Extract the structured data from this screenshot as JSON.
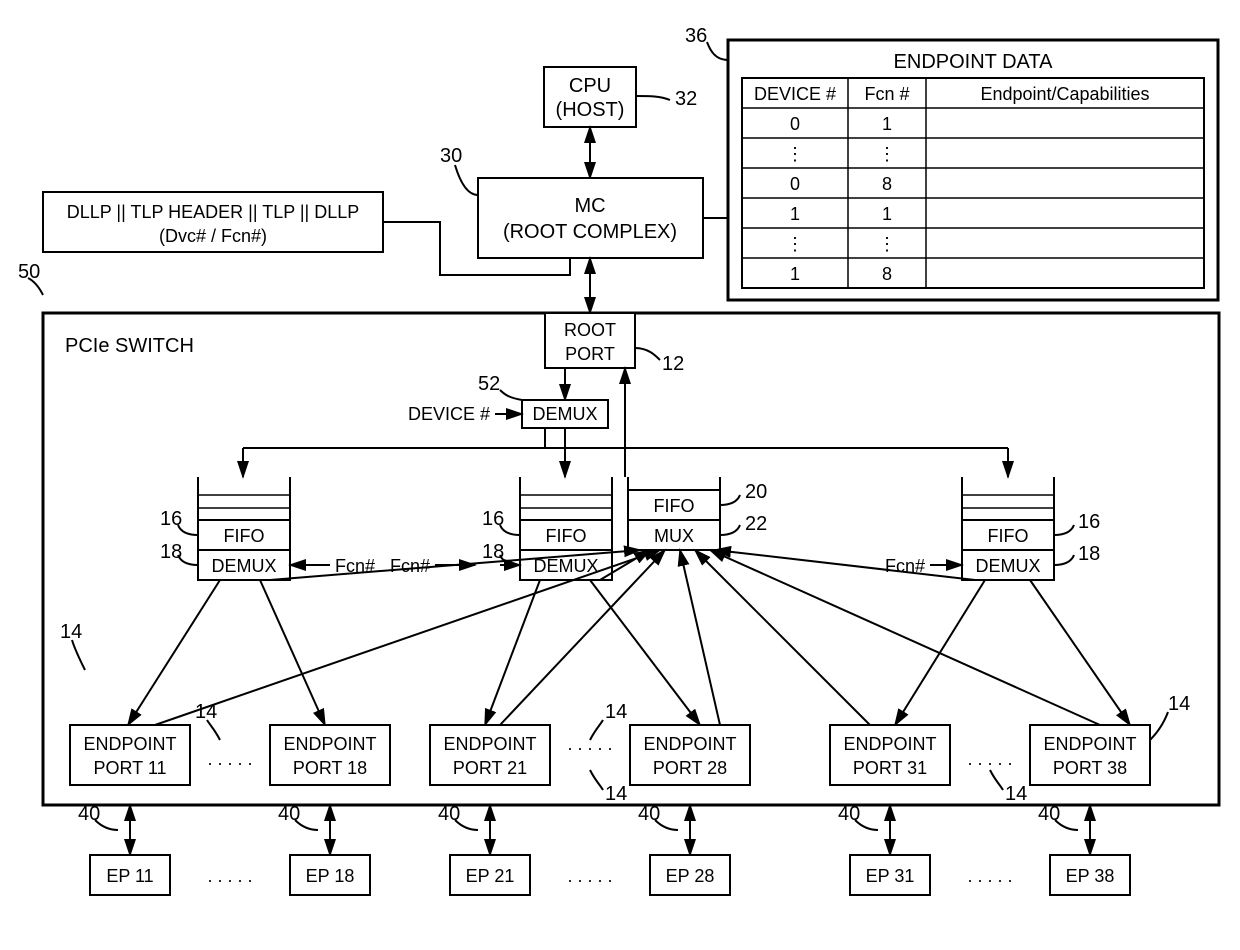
{
  "diagram": {
    "cpu": {
      "line1": "CPU",
      "line2": "(HOST)",
      "ref": "32"
    },
    "mc": {
      "line1": "MC",
      "line2": "(ROOT COMPLEX)",
      "ref": "30"
    },
    "endpoint_data": {
      "title": "ENDPOINT DATA",
      "ref": "36",
      "headers": [
        "DEVICE #",
        "Fcn #",
        "Endpoint/Capabilities"
      ],
      "rows": [
        [
          "0",
          "1",
          ""
        ],
        [
          "⋮",
          "⋮",
          ""
        ],
        [
          "0",
          "8",
          ""
        ],
        [
          "1",
          "1",
          ""
        ],
        [
          "⋮",
          "⋮",
          ""
        ],
        [
          "1",
          "8",
          ""
        ]
      ]
    },
    "packet": {
      "text": "DLLP || TLP HEADER || TLP || DLLP",
      "sub": "(Dvc# / Fcn#)"
    },
    "switch": {
      "label": "PCIe SWITCH",
      "ref": "50"
    },
    "root_port": {
      "line1": "ROOT",
      "line2": "PORT",
      "ref": "12"
    },
    "demux_top": {
      "label": "DEMUX",
      "ref": "52",
      "input": "DEVICE #"
    },
    "fifo": "FIFO",
    "demux": "DEMUX",
    "mux": "MUX",
    "fcn_label": "Fcn#",
    "ref_16": "16",
    "ref_18": "18",
    "ref_20": "20",
    "ref_22": "22",
    "ref_14": "14",
    "ref_40": "40",
    "endpoint_ports": [
      {
        "line1": "ENDPOINT",
        "line2": "PORT 11"
      },
      {
        "line1": "ENDPOINT",
        "line2": "PORT 18"
      },
      {
        "line1": "ENDPOINT",
        "line2": "PORT 21"
      },
      {
        "line1": "ENDPOINT",
        "line2": "PORT 28"
      },
      {
        "line1": "ENDPOINT",
        "line2": "PORT 31"
      },
      {
        "line1": "ENDPOINT",
        "line2": "PORT 38"
      }
    ],
    "eps": [
      "EP 11",
      "EP 18",
      "EP 21",
      "EP 28",
      "EP 31",
      "EP 38"
    ],
    "dots": ". . . . ."
  }
}
